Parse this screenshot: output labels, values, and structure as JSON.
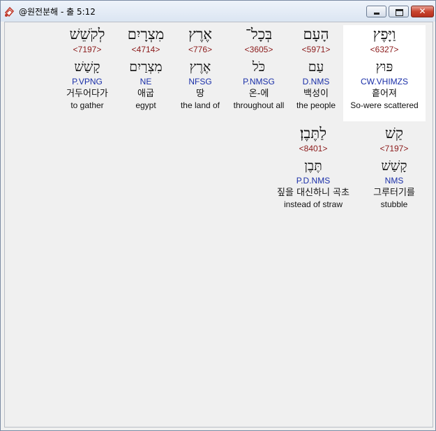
{
  "window": {
    "title": "@원전분해 - 출 5:12"
  },
  "words": [
    {
      "hebrew": "וַיָּפֶץ",
      "strong": "<6327>",
      "lemma": "פּוּץ",
      "parse": "CW.VHIMZS",
      "korean": "흩어져",
      "english": "So-were scattered",
      "highlight": true
    },
    {
      "hebrew": "הָעָם",
      "strong": "<5971>",
      "lemma": "עַם",
      "parse": "D.NMS",
      "korean": "백성이",
      "english": "the people",
      "highlight": false
    },
    {
      "hebrew": "בְּכָל־",
      "strong": "<3605>",
      "lemma": "כֹּל",
      "parse": "P.NMSG",
      "korean": "온-에",
      "english": "throughout all",
      "highlight": false
    },
    {
      "hebrew": "אֶרֶץ",
      "strong": "<776>",
      "lemma": "אֶרֶץ",
      "parse": "NFSG",
      "korean": "땅",
      "english": "the land of",
      "highlight": false
    },
    {
      "hebrew": "מִצְרָיִם",
      "strong": "<4714>",
      "lemma": "מִצְרַיִם",
      "parse": "NE",
      "korean": "애굽",
      "english": "egypt",
      "highlight": false
    },
    {
      "hebrew": "לְקֹשֵׁשׁ",
      "strong": "<7197>",
      "lemma": "קָשַׁשׁ",
      "parse": "P.VPNG",
      "korean": "거두어다가",
      "english": "to gather",
      "highlight": false
    },
    {
      "hebrew": "קַשׁ",
      "strong": "<7197>",
      "lemma": "קָשַׁשׁ",
      "parse": "NMS",
      "korean": "그루터기를",
      "english": "stubble",
      "highlight": false
    },
    {
      "hebrew": "לַתֶּבֶן׃",
      "strong": "<8401>",
      "lemma": "תֶּבֶן",
      "parse": "P.D.NMS",
      "korean": "짚을 대신하니 곡초",
      "english": "instead of straw",
      "highlight": false
    }
  ]
}
